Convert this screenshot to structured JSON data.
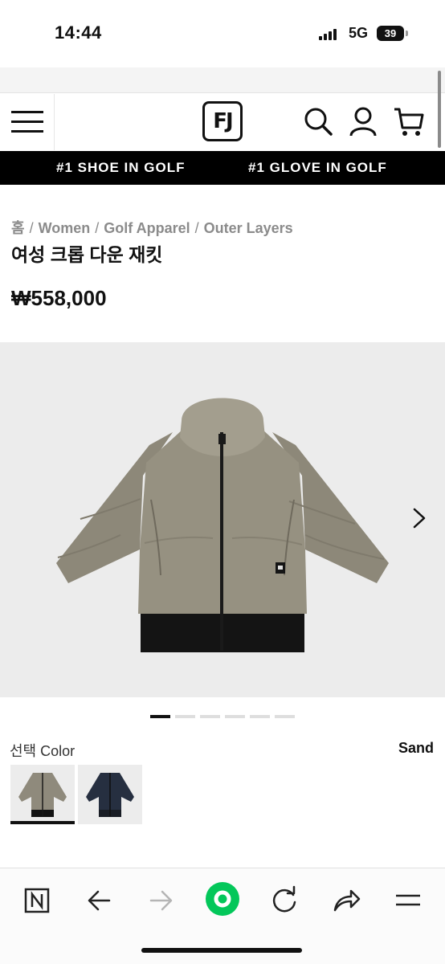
{
  "status_bar": {
    "time": "14:44",
    "network": "5G",
    "battery": "39"
  },
  "header": {
    "logo": "FJ",
    "icons": [
      "menu-icon",
      "search-icon",
      "user-icon",
      "cart-icon"
    ]
  },
  "promo": {
    "left": "#1 SHOE IN GOLF",
    "right": "#1 GLOVE IN GOLF"
  },
  "breadcrumb": [
    "홈",
    "Women",
    "Golf Apparel",
    "Outer Layers"
  ],
  "breadcrumb_separator": "/",
  "product": {
    "title": "여성 크롭 다운 재킷",
    "price": "₩558,000"
  },
  "gallery": {
    "slide_count": 6,
    "active_index": 0
  },
  "color": {
    "label": "선택 Color",
    "selected": "Sand",
    "swatches": [
      {
        "name": "Sand",
        "hex": "#8f8a7c",
        "selected": true
      },
      {
        "name": "Navy",
        "hex": "#262f40",
        "selected": false
      }
    ]
  },
  "colors": {
    "promo_bg": "#000000",
    "active_indicator": "#111111",
    "browser_accent": "#03c75a"
  },
  "browser": {
    "icons": [
      "naver-n-icon",
      "back-arrow-icon",
      "forward-arrow-icon",
      "green-home-icon",
      "reload-icon",
      "share-icon",
      "hamburger-menu-icon"
    ]
  }
}
